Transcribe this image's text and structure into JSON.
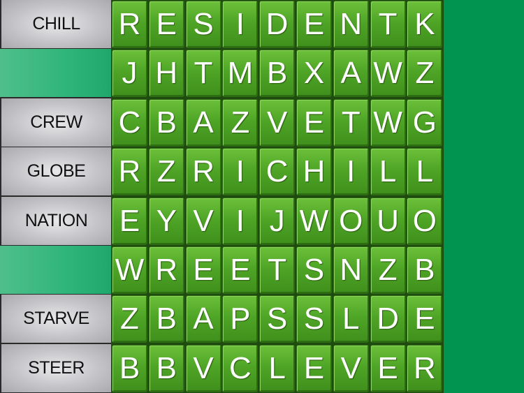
{
  "word_list": [
    {
      "text": "CHILL",
      "found": false
    },
    {
      "text": "",
      "found": true
    },
    {
      "text": "CREW",
      "found": false
    },
    {
      "text": "GLOBE",
      "found": false
    },
    {
      "text": "NATION",
      "found": false
    },
    {
      "text": "",
      "found": true
    },
    {
      "text": "STARVE",
      "found": false
    },
    {
      "text": "STEER",
      "found": false
    }
  ],
  "grid": [
    [
      "R",
      "E",
      "S",
      "I",
      "D",
      "E",
      "N",
      "T",
      "K"
    ],
    [
      "J",
      "H",
      "T",
      "M",
      "B",
      "X",
      "A",
      "W",
      "Z"
    ],
    [
      "C",
      "B",
      "A",
      "Z",
      "V",
      "E",
      "T",
      "W",
      "G"
    ],
    [
      "R",
      "Z",
      "R",
      "I",
      "C",
      "H",
      "I",
      "L",
      "L"
    ],
    [
      "E",
      "Y",
      "V",
      "I",
      "J",
      "W",
      "O",
      "U",
      "O"
    ],
    [
      "W",
      "R",
      "E",
      "E",
      "T",
      "S",
      "N",
      "Z",
      "B"
    ],
    [
      "Z",
      "B",
      "A",
      "P",
      "S",
      "S",
      "L",
      "D",
      "E"
    ],
    [
      "B",
      "B",
      "V",
      "C",
      "L",
      "E",
      "V",
      "E",
      "R"
    ]
  ],
  "colors": {
    "background": "#009450",
    "tile": "#4fa526",
    "found_highlight": "#2fb57a"
  }
}
